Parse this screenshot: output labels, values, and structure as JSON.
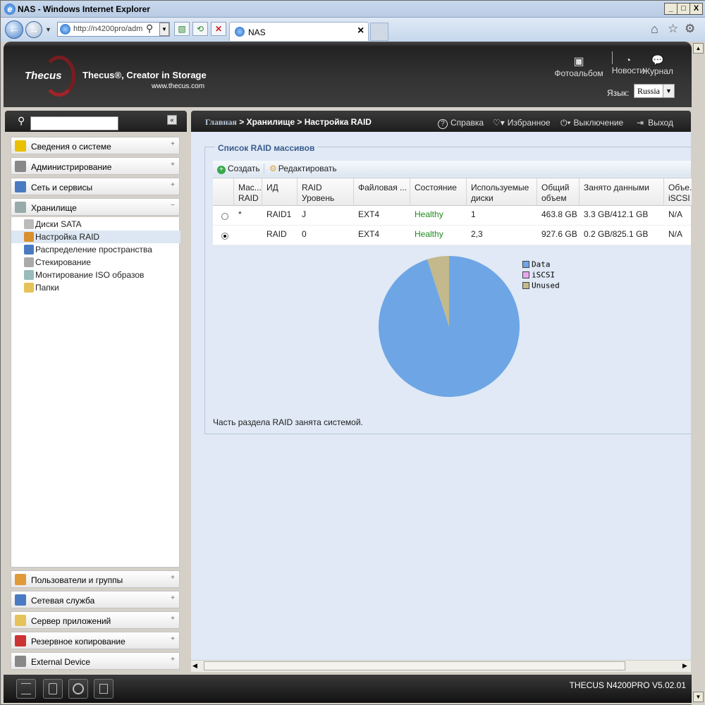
{
  "window": {
    "title": "NAS - Windows Internet Explorer",
    "min": "_",
    "max": "□",
    "close": "X"
  },
  "browser": {
    "address": "http://n4200pro/adm",
    "tab_title": "NAS",
    "tab_close": "×"
  },
  "header": {
    "brand": "Thecus",
    "slogan": "Thecus®, Creator in Storage",
    "url": "www.thecus.com",
    "links": {
      "photo": "Фотоальбом",
      "news": "Новости",
      "journal": "Журнал"
    },
    "lang_label": "Язык:",
    "lang_value": "Russia"
  },
  "sidebar": {
    "search_placeholder": "",
    "sections": [
      {
        "label": "Сведения о системе",
        "icon": "info-icon",
        "color": "#e8c000"
      },
      {
        "label": "Администрирование",
        "icon": "tools-icon",
        "color": "#888"
      },
      {
        "label": "Сеть и сервисы",
        "icon": "network-icon",
        "color": "#4a7bc2"
      },
      {
        "label": "Хранилище",
        "icon": "storage-icon",
        "color": "#9aa"
      }
    ],
    "storage_items": [
      {
        "label": "Диски SATA",
        "icon": "disk-icon",
        "color": "#bbb"
      },
      {
        "label": "Настройка RAID",
        "icon": "raid-icon",
        "color": "#d88f2f",
        "selected": true
      },
      {
        "label": "Распределение пространства",
        "icon": "space-icon",
        "color": "#4a7bc2"
      },
      {
        "label": "Стекирование",
        "icon": "stack-icon",
        "color": "#aaa"
      },
      {
        "label": "Монтирование ISO образов",
        "icon": "iso-icon",
        "color": "#9bb"
      },
      {
        "label": "Папки",
        "icon": "folder-icon",
        "color": "#e6c25a"
      }
    ],
    "bottom_sections": [
      {
        "label": "Пользователи и группы",
        "icon": "users-icon",
        "color": "#e19a3a"
      },
      {
        "label": "Сетевая служба",
        "icon": "network-service-icon",
        "color": "#4a7bc2"
      },
      {
        "label": "Сервер приложений",
        "icon": "app-server-icon",
        "color": "#e6c25a"
      },
      {
        "label": "Резервное копирование",
        "icon": "backup-icon",
        "color": "#c33"
      },
      {
        "label": "External Device",
        "icon": "external-device-icon",
        "color": "#888"
      }
    ]
  },
  "topbar": {
    "breadcrumb_home": "Главная",
    "breadcrumb_rest": " > Хранилище > Настройка RAID",
    "help": "Справка",
    "favorites": "Избранное",
    "shutdown": "Выключение",
    "logout": "Выход"
  },
  "panel": {
    "legend": "Список RAID массивов",
    "toolbar": {
      "create": "Создать",
      "edit": "Редактировать"
    },
    "columns": [
      "Мас... RAID",
      "ИД",
      "RAID Уровень",
      "Файловая ...",
      "Состояние",
      "Используемые диски",
      "Общий объем",
      "Занято данными",
      "Объе... iSCSI"
    ],
    "rows": [
      {
        "selected": false,
        "master": "*",
        "id": "RAID1",
        "level": "J",
        "fs": "EXT4",
        "status": "Healthy",
        "disks": "1",
        "total": "463.8 GB",
        "used": "3.3 GB/412.1 GB",
        "iscsi": "N/A"
      },
      {
        "selected": true,
        "master": "",
        "id": "RAID",
        "level": "0",
        "fs": "EXT4",
        "status": "Healthy",
        "disks": "2,3",
        "total": "927.6 GB",
        "used": "0.2 GB/825.1 GB",
        "iscsi": "N/A"
      }
    ],
    "note": "Часть раздела RAID занята системой."
  },
  "chart_data": {
    "type": "pie",
    "slices": [
      {
        "name": "Data",
        "value": 95,
        "color": "#6ea6e5"
      },
      {
        "name": "iSCSI",
        "value": 0,
        "color": "#e6a8ee"
      },
      {
        "name": "Unused",
        "value": 5,
        "color": "#c4b98c"
      }
    ]
  },
  "footer": {
    "version": "THECUS N4200PRO V5.02.01"
  }
}
